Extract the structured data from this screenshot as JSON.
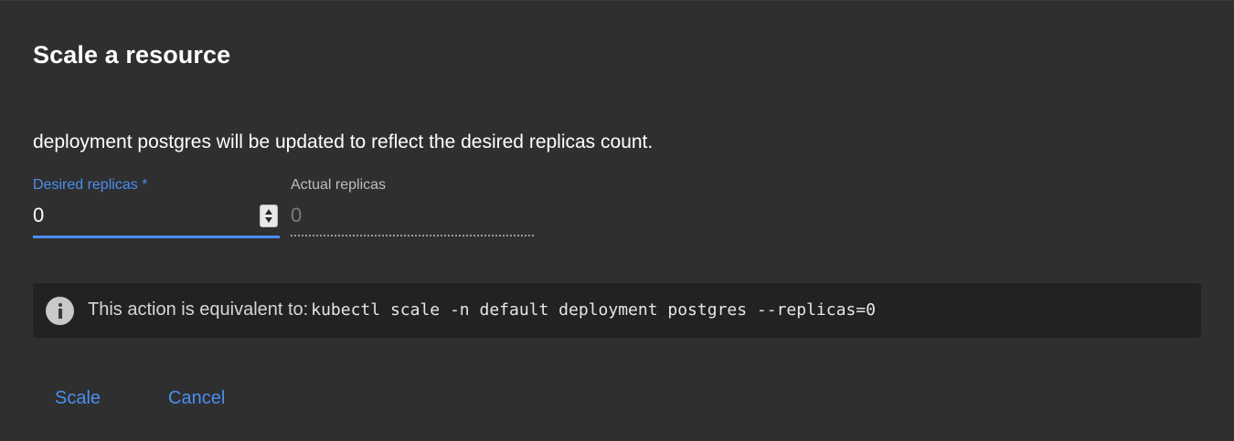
{
  "dialog": {
    "title": "Scale a resource",
    "description": "deployment postgres will be updated to reflect the desired replicas count."
  },
  "desired_replicas": {
    "label": "Desired replicas *",
    "value": "0"
  },
  "actual_replicas": {
    "label": "Actual replicas",
    "value": "0"
  },
  "info": {
    "icon": "info-icon",
    "text": "This action is equivalent to:",
    "command": "kubectl scale -n default deployment postgres --replicas=0"
  },
  "actions": {
    "scale_label": "Scale",
    "cancel_label": "Cancel"
  },
  "colors": {
    "background": "#2f2f2f",
    "accent": "#4b8ef1",
    "info_background": "#222222"
  }
}
